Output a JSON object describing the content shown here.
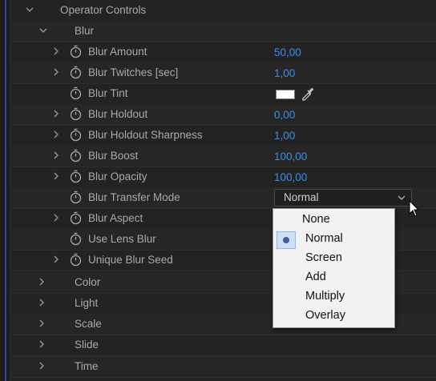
{
  "tree": {
    "operator_controls": "Operator Controls",
    "blur_group": "Blur",
    "params": [
      {
        "label": "Blur Amount",
        "value": "50,00"
      },
      {
        "label": "Blur Twitches [sec]",
        "value": "1,00"
      },
      {
        "label": "Blur Tint"
      },
      {
        "label": "Blur Holdout",
        "value": "0,00"
      },
      {
        "label": "Blur Holdout Sharpness",
        "value": "1,00"
      },
      {
        "label": "Blur Boost",
        "value": "100,00"
      },
      {
        "label": "Blur Opacity",
        "value": "100,00"
      },
      {
        "label": "Blur Transfer Mode",
        "value": "Normal"
      },
      {
        "label": "Blur Aspect"
      },
      {
        "label": "Use Lens Blur"
      },
      {
        "label": "Unique Blur Seed"
      }
    ],
    "groups": [
      "Color",
      "Light",
      "Scale",
      "Slide",
      "Time"
    ]
  },
  "tint_color": "#ffffff",
  "dropdown": {
    "selected": "Normal",
    "options": [
      "None",
      "Normal",
      "Screen",
      "Add",
      "Multiply",
      "Overlay"
    ]
  },
  "colors": {
    "value_blue": "#3d8fe6",
    "background": "#232323"
  }
}
